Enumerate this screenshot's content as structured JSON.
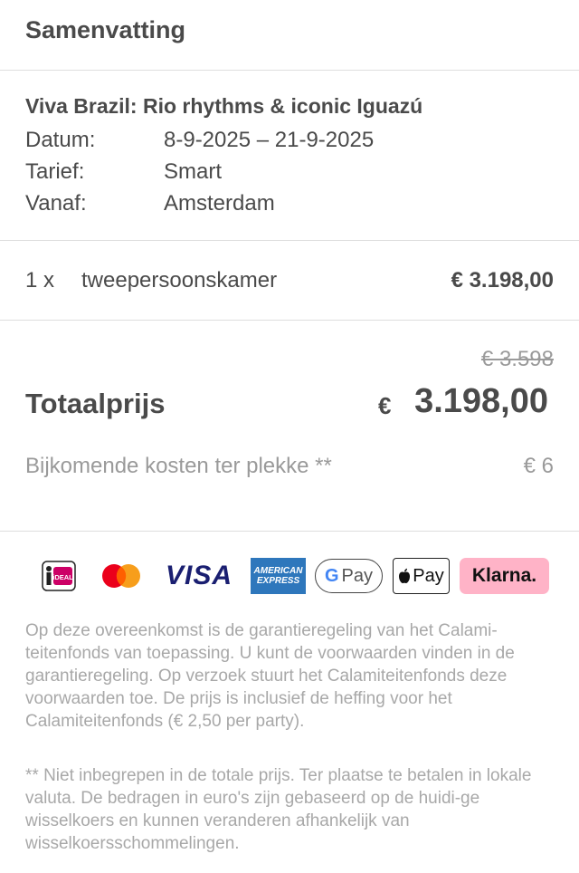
{
  "summary": {
    "title": "Samenvatting"
  },
  "trip": {
    "name": "Viva Brazil: Rio rhythms & iconic Iguazú",
    "date_label": "Datum:",
    "date_value": "8-9-2025 – 21-9-2025",
    "tariff_label": "Tarief:",
    "tariff_value": "Smart",
    "from_label": "Vanaf:",
    "from_value": "Amsterdam"
  },
  "room": {
    "quantity": "1 x",
    "type": "tweepersoonskamer",
    "price": "€ 3.198,00"
  },
  "total": {
    "old_price": "€ 3.598",
    "label": "Totaalprijs",
    "currency": "€",
    "amount": "3.198,00",
    "extra_label": "Bijkomende kosten ter plekke **",
    "extra_amount": "€ 6"
  },
  "payment_methods": [
    {
      "name": "ideal-icon",
      "text": "iDEAL"
    },
    {
      "name": "mastercard-icon",
      "text": ""
    },
    {
      "name": "visa-icon",
      "text": "VISA"
    },
    {
      "name": "amex-icon",
      "text": "AMERICAN EXPRESS"
    },
    {
      "name": "gpay-icon",
      "text": "Pay"
    },
    {
      "name": "applepay-icon",
      "text": "Pay"
    },
    {
      "name": "klarna-icon",
      "text": "Klarna."
    }
  ],
  "colors": {
    "mastercard_red": "#eb001b",
    "mastercard_orange": "#f79e1b",
    "visa_blue": "#1a1f71",
    "amex_blue": "#2e77bc",
    "klarna_pink": "#ffb3c7",
    "ideal_pink": "#cc0066"
  },
  "notes": {
    "guarantee": "Op deze overeenkomst is de garantieregeling van het Calami-teitenfonds van toepassing. U kunt de voorwaarden vinden in de garantieregeling. Op verzoek stuurt het Calamiteitenfonds deze voorwaarden toe. De prijs is inclusief de heffing voor het Calamiteitenfonds (€ 2,50 per party).",
    "footnote": "** Niet inbegrepen in de totale prijs. Ter plaatse te betalen in lokale valuta. De bedragen in euro's zijn gebaseerd op de huidi-ge wisselkoers en kunnen veranderen afhankelijk van wisselkoersschommelingen."
  }
}
